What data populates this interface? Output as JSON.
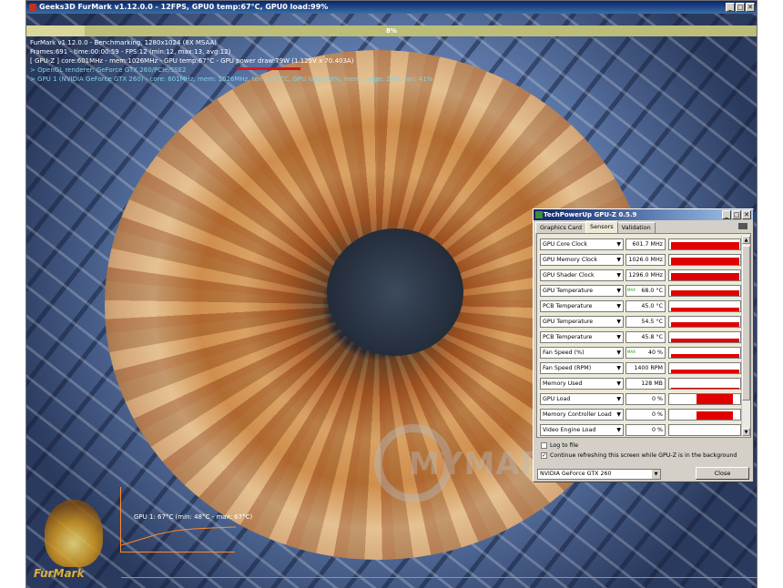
{
  "window": {
    "title": "Geeks3D FurMark v1.12.0.0 - 12FPS, GPU0 temp:67°C, GPU0 load:99%",
    "buttons": [
      "_",
      "□",
      "✕"
    ]
  },
  "progress": {
    "label": "8%",
    "value": 0.08
  },
  "overlay": {
    "line1": "FurMark v1.12.0.0 - Benchmarking, 1280x1024 (8X MSAA)",
    "line2": "Frames:691 - time:00:00:59 - FPS:12 (min:12, max:13, avg:12)",
    "line3": "[ GPU-Z ] core:601MHz - mem:1026MHz - GPU temp:67°C - GPU power draw:79W (1.125V x 70.403A)",
    "line4": "> OpenGL renderer: GeForce GTX 260/PCIe/SSE2",
    "line5": "> GPU 1 (NVIDIA GeForce GTX 260) - core: 601MHz, mem: 1026MHz, temp: 67°C, GPU load: 99%, mem usage: 24%, fan: 41%"
  },
  "temp_graph": {
    "label": "GPU 1: 67°C (min: 48°C - max: 67°C)"
  },
  "logo": {
    "text": "FurMark"
  },
  "watermark": {
    "text": "MYMARKET.GE"
  },
  "gpuz": {
    "title": "TechPowerUp GPU-Z 0.5.9",
    "tabs": [
      "Graphics Card",
      "Sensors",
      "Validation"
    ],
    "active_tab": "Sensors",
    "sensors": [
      {
        "name": "GPU Core Clock",
        "value": "601.7 MHz",
        "level": 0.75,
        "max": ""
      },
      {
        "name": "GPU Memory Clock",
        "value": "1026.0 MHz",
        "level": 0.75,
        "max": ""
      },
      {
        "name": "GPU Shader Clock",
        "value": "1296.0 MHz",
        "level": 0.75,
        "max": ""
      },
      {
        "name": "GPU Temperature",
        "value": "68.0 °C",
        "level": 0.55,
        "max": "MAX"
      },
      {
        "name": "PCB Temperature",
        "value": "45.0 °C",
        "level": 0.4,
        "max": ""
      },
      {
        "name": "GPU Temperature",
        "value": "54.5 °C",
        "level": 0.45,
        "max": ""
      },
      {
        "name": "PCB Temperature",
        "value": "45.8 °C",
        "level": 0.4,
        "max": ""
      },
      {
        "name": "Fan Speed (%)",
        "value": "40 %",
        "level": 0.4,
        "max": "MAX"
      },
      {
        "name": "Fan Speed (RPM)",
        "value": "1400 RPM",
        "level": 0.4,
        "max": ""
      },
      {
        "name": "Memory Used",
        "value": "128 MB",
        "level": 0.1,
        "max": ""
      },
      {
        "name": "GPU Load",
        "value": "0 %",
        "level": 0.99,
        "max": ""
      },
      {
        "name": "Memory Controller Load",
        "value": "0 %",
        "level": 0.85,
        "max": ""
      },
      {
        "name": "Video Engine Load",
        "value": "0 %",
        "level": 0.0,
        "max": ""
      }
    ],
    "log_label": "Log to file",
    "refresh_label": "Continue refreshing this screen while GPU-Z is in the background",
    "device": "NVIDIA GeForce GTX 260",
    "close_label": "Close"
  }
}
